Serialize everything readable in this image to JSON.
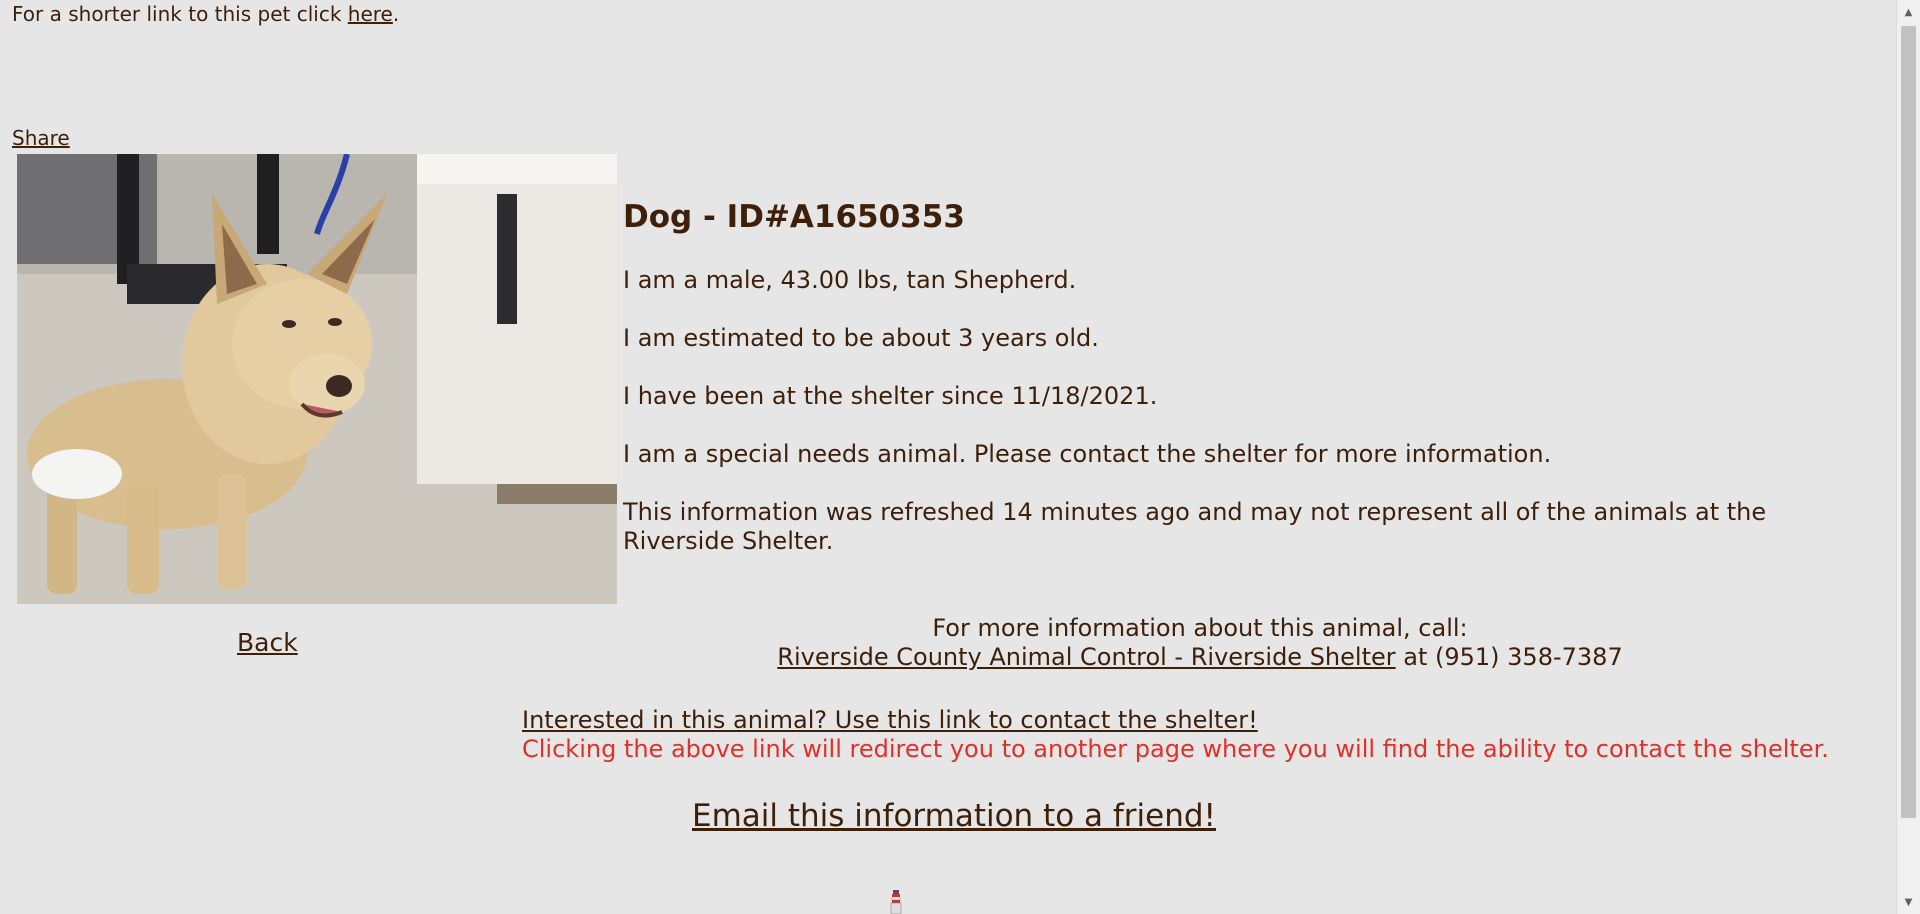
{
  "shortlink": {
    "prefix": "For a shorter link to this pet click ",
    "link_label": "here",
    "suffix": "."
  },
  "share_label": "Share",
  "animal": {
    "title": "Dog - ID#A1650353",
    "lines": [
      "I am a male, 43.00 lbs, tan Shepherd.",
      "I am estimated to be about 3 years old.",
      "I have been at the shelter since 11/18/2021.",
      "I am a special needs animal. Please contact the shelter for more information.",
      "This information was refreshed 14 minutes ago and may not represent all of the animals at the Riverside Shelter."
    ]
  },
  "back_label": "Back",
  "contact": {
    "intro": "For more information about this animal, call:",
    "shelter_link": "Riverside County Animal Control - Riverside Shelter",
    "phone_text": " at (951) 358-7387"
  },
  "interested": {
    "link_label": "Interested in this animal? Use this link to contact the shelter!",
    "note": "Clicking the above link will redirect you to another page where you will find the ability to contact the shelter."
  },
  "email_label": "Email this information to a friend!",
  "colors": {
    "background": "#e6e6e6",
    "text": "#3d1f0a",
    "warning": "#e0302a"
  }
}
